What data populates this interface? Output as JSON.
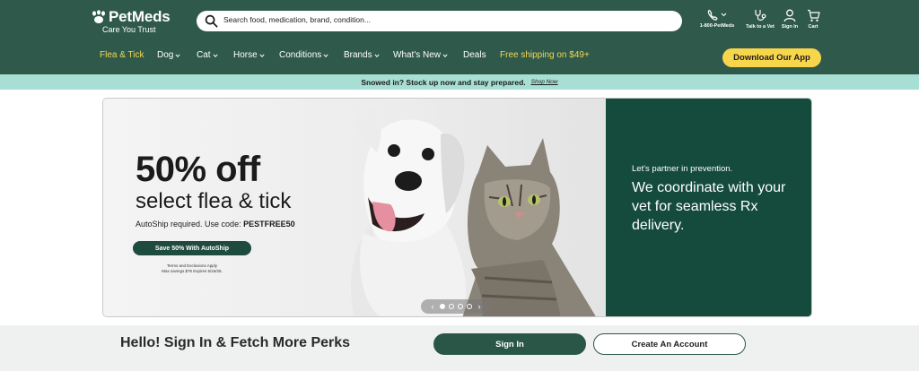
{
  "header": {
    "logo": {
      "name": "PetMeds",
      "tagline": "Care You Trust"
    },
    "search": {
      "placeholder": "Search food, medication, brand, condition..."
    },
    "utilities": [
      {
        "label": "1-800-PetMeds",
        "icon": "phone-icon"
      },
      {
        "label": "Talk to a Vet",
        "icon": "stethoscope-icon"
      },
      {
        "label": "Sign In",
        "icon": "user-icon"
      },
      {
        "label": "Cart",
        "icon": "cart-icon"
      }
    ],
    "nav": [
      {
        "label": "Flea & Tick",
        "dropdown": false,
        "highlight": true
      },
      {
        "label": "Dog",
        "dropdown": true
      },
      {
        "label": "Cat",
        "dropdown": true
      },
      {
        "label": "Horse",
        "dropdown": true
      },
      {
        "label": "Conditions",
        "dropdown": true
      },
      {
        "label": "Brands",
        "dropdown": true
      },
      {
        "label": "What's New",
        "dropdown": true
      },
      {
        "label": "Deals",
        "dropdown": false
      },
      {
        "label": "Free shipping on $49+",
        "dropdown": false,
        "highlight": true
      }
    ],
    "app_button": "Download Our App"
  },
  "promo": {
    "text": "Snowed in? Stock up now and stay prepared.",
    "link": "Shop Now"
  },
  "hero": {
    "title": "50% off",
    "subtitle": "select flea & tick",
    "code_prefix": "AutoShip required. Use code: ",
    "code": "PESTFREE50",
    "cta": "Save 50% With AutoShip",
    "terms_line1": "Terms and Exclusions Apply",
    "terms_line2": "Max savings $75 Expires 5/15/26.",
    "carousel": {
      "total": 4,
      "active": 1,
      "prev_icon": "‹",
      "next_icon": "›"
    },
    "partner_small": "Let's partner in prevention.",
    "partner_big": "We coordinate with your vet for seamless Rx delivery."
  },
  "signin": {
    "heading": "Hello! Sign In & Fetch More Perks",
    "sign_in_button": "Sign In",
    "create_account_button": "Create An Account"
  },
  "colors": {
    "header_bg": "#2f5a4b",
    "promo_bg": "#a8dfd4",
    "accent_yellow": "#f8d64c",
    "hero_panel_green": "#154b3d",
    "button_green": "#2a5648"
  }
}
